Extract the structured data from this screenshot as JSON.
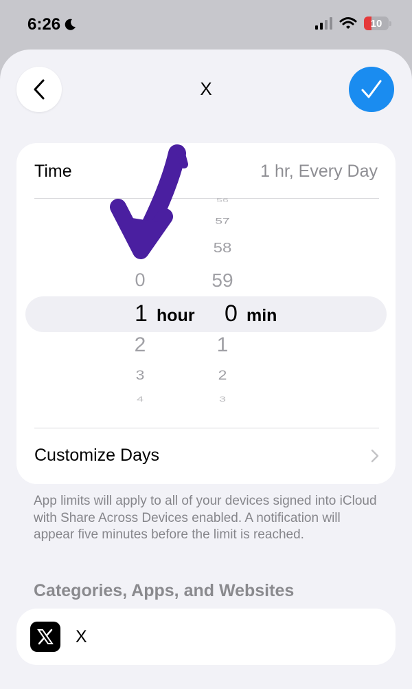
{
  "status_bar": {
    "time": "6:26",
    "battery_level": "10",
    "focus_icon": "moon-icon"
  },
  "header": {
    "title": "X",
    "back_icon": "chevron-left-icon",
    "done_icon": "checkmark-icon",
    "accent_color": "#1a8cf0"
  },
  "time_row": {
    "label": "Time",
    "value": "1 hr, Every Day"
  },
  "picker": {
    "hours": [
      "0",
      "1",
      "2",
      "3",
      "4"
    ],
    "minutes": [
      "57",
      "58",
      "59",
      "0",
      "1",
      "2",
      "3"
    ],
    "selected_hour": "1",
    "selected_minute": "0",
    "hour_unit": "hour",
    "minute_unit": "min"
  },
  "customize_row": {
    "label": "Customize Days"
  },
  "footnote": "App limits will apply to all of your devices signed into iCloud with Share Across Devices enabled. A notification will appear five minutes before the limit is reached.",
  "section": {
    "title": "Categories, Apps, and Websites"
  },
  "apps": [
    {
      "name": "X",
      "icon": "x-logo-icon"
    }
  ],
  "annotation": {
    "color": "#4a1fa0",
    "icon": "hand-drawn-arrow-icon"
  }
}
